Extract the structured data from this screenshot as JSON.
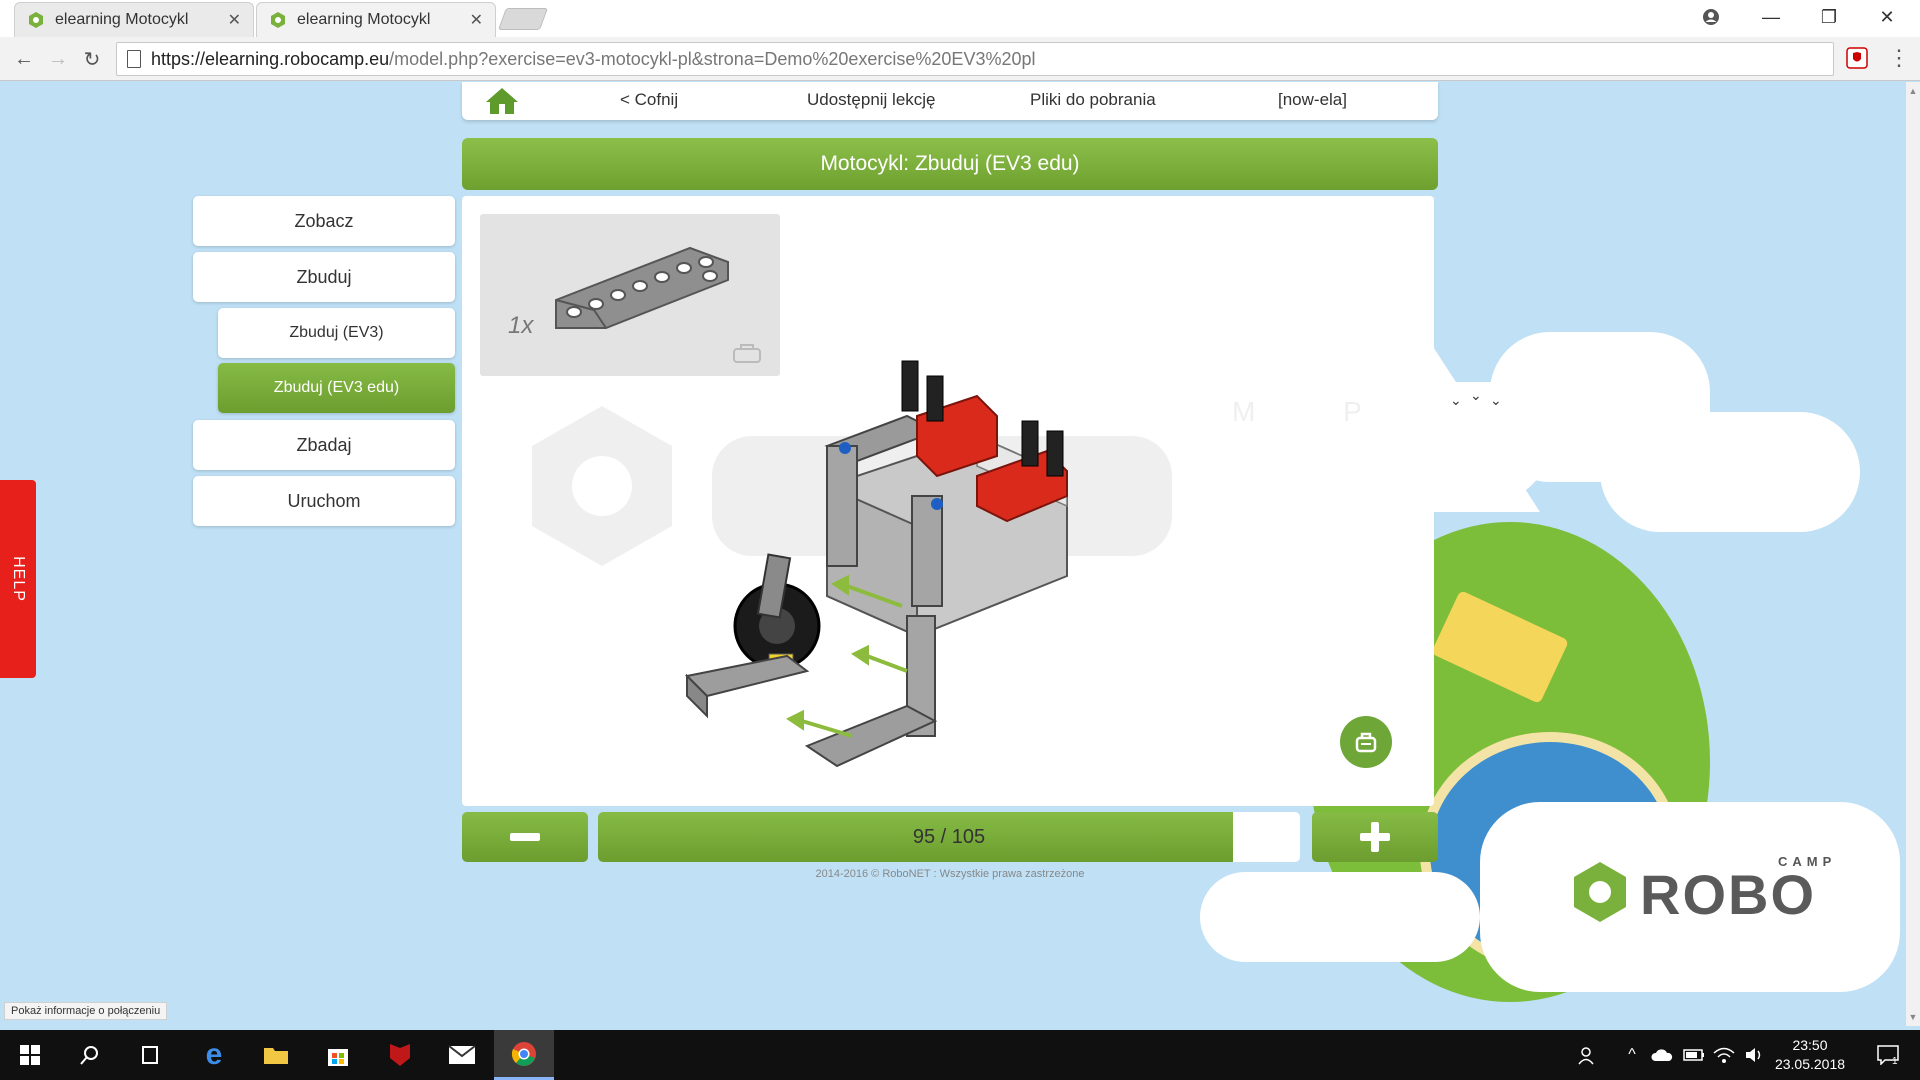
{
  "browser": {
    "tabs": [
      {
        "title": "elearning Motocykl",
        "active": false
      },
      {
        "title": "elearning Motocykl",
        "active": true
      }
    ],
    "url_host": "https://elearning.robocamp.eu",
    "url_path": "/model.php?exercise=ev3-motocykl-pl&strona=Demo%20exercise%20EV3%20pl",
    "status_tip": "Pokaż informacje o połączeniu"
  },
  "topnav": {
    "back": "< Cofnij",
    "share": "Udostępnij lekcję",
    "downloads": "Pliki do pobrania",
    "user": "[now-ela]"
  },
  "header": {
    "title": "Motocykl: Zbuduj (EV3 edu)"
  },
  "sidebar": {
    "items": [
      {
        "label": "Zobacz"
      },
      {
        "label": "Zbuduj"
      },
      {
        "label": "Zbuduj (EV3)"
      },
      {
        "label": "Zbuduj (EV3 edu)",
        "active": true
      },
      {
        "label": "Zbadaj"
      },
      {
        "label": "Uruchom"
      }
    ]
  },
  "part": {
    "quantity": "1x"
  },
  "progress": {
    "current": 95,
    "total": 105,
    "label": "95 / 105"
  },
  "footer": "2014-2016 © RoboNET : Wszystkie prawa zastrzeżone",
  "help": "HELP",
  "logo": {
    "small": "CAMP",
    "big": "ROBO"
  },
  "watermark_letters": "M P",
  "taskbar": {
    "time": "23:50",
    "date": "23.05.2018",
    "notifications": "1"
  },
  "colors": {
    "accent_green": "#7ab03c",
    "help_red": "#e8201c",
    "sky": "#bfe0f5"
  }
}
